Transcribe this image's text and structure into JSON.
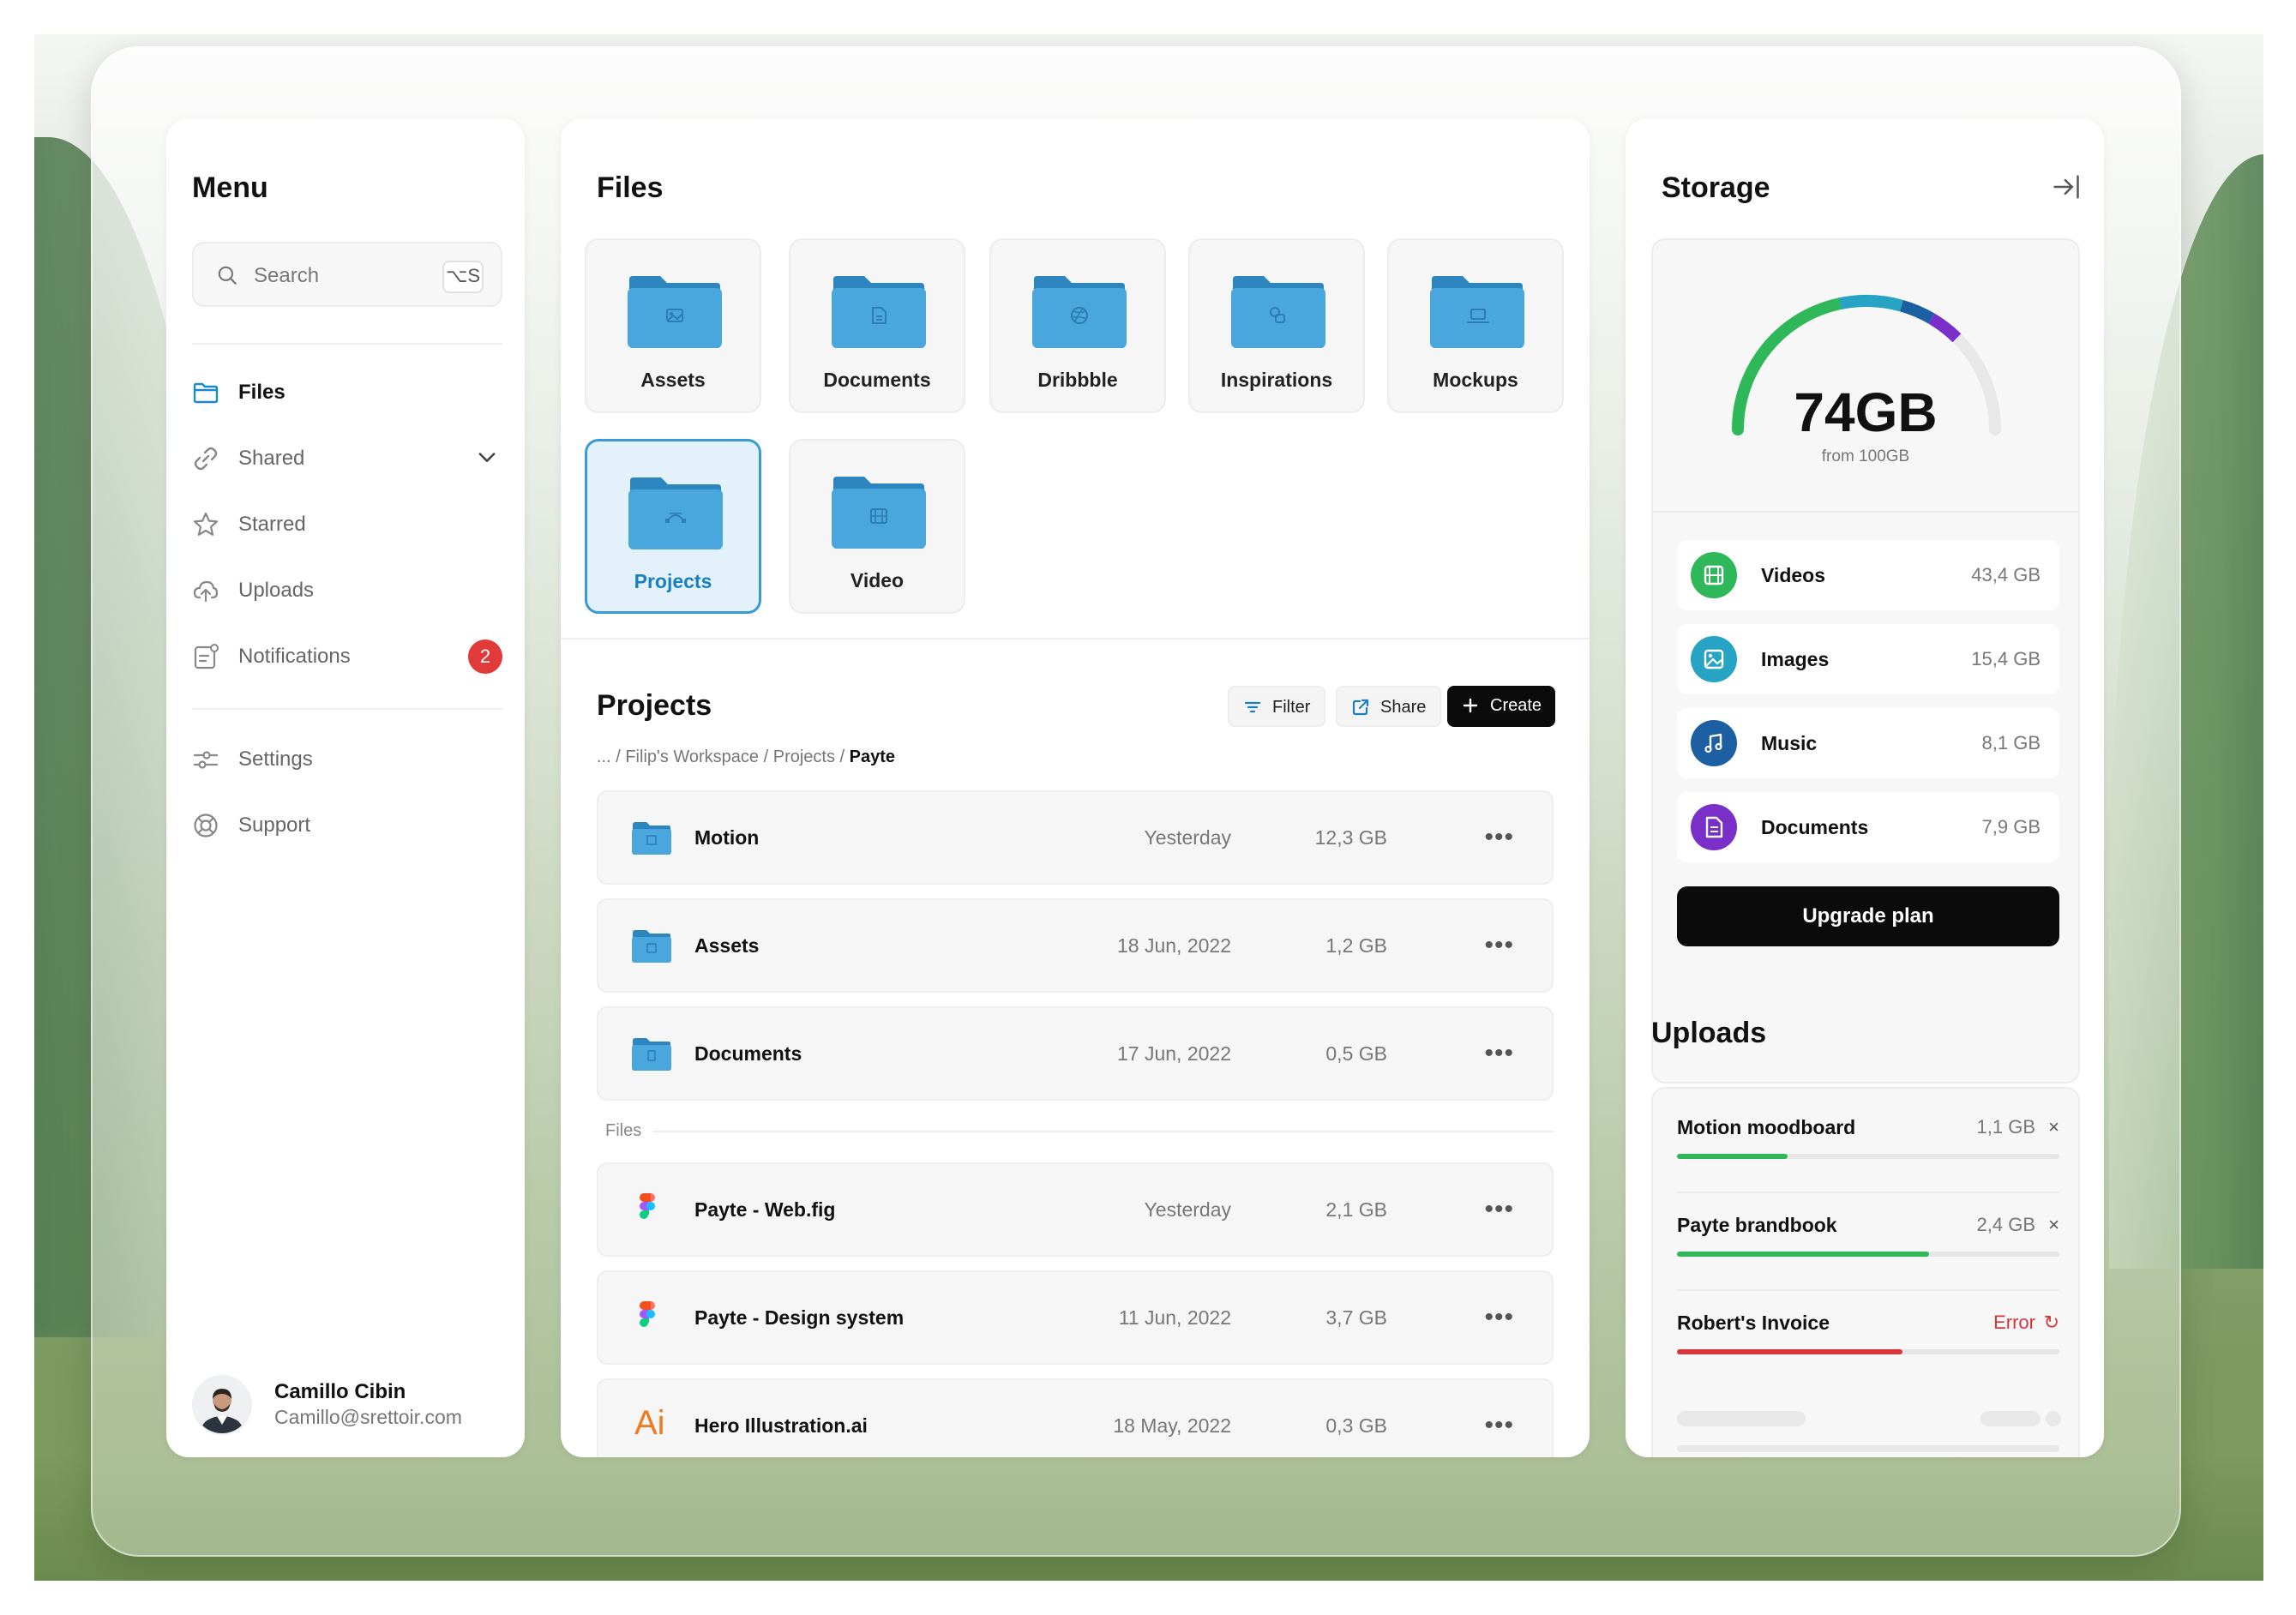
{
  "menu": {
    "title": "Menu",
    "search": {
      "placeholder": "Search",
      "shortcut": "⌥S"
    },
    "items": [
      {
        "label": "Files",
        "icon": "folder-icon",
        "active": true
      },
      {
        "label": "Shared",
        "icon": "link-icon"
      },
      {
        "label": "Starred",
        "icon": "star-icon"
      },
      {
        "label": "Uploads",
        "icon": "cloud-upload-icon"
      },
      {
        "label": "Notifications",
        "icon": "notification-icon",
        "badge": "2"
      }
    ],
    "bottom_items": [
      {
        "label": "Settings",
        "icon": "settings-sliders-icon"
      },
      {
        "label": "Support",
        "icon": "lifebuoy-icon"
      }
    ],
    "user": {
      "name": "Camillo Cibin",
      "email": "Camillo@srettoir.com"
    }
  },
  "files": {
    "title": "Files",
    "folders": [
      {
        "label": "Assets",
        "icon": "image-icon"
      },
      {
        "label": "Documents",
        "icon": "document-icon"
      },
      {
        "label": "Dribbble",
        "icon": "dribbble-icon"
      },
      {
        "label": "Inspirations",
        "icon": "shapes-icon"
      },
      {
        "label": "Mockups",
        "icon": "laptop-icon"
      },
      {
        "label": "Projects",
        "icon": "pen-tool-icon",
        "selected": true
      },
      {
        "label": "Video",
        "icon": "film-icon"
      }
    ],
    "folder_color": "#3d9ad3"
  },
  "projects": {
    "title": "Projects",
    "buttons": {
      "filter": "Filter",
      "share": "Share",
      "create": "Create"
    },
    "breadcrumb": {
      "path": "... / Filip's Workspace / Projects / ",
      "current": "Payte"
    },
    "folders": [
      {
        "name": "Motion",
        "date": "Yesterday",
        "size": "12,3 GB",
        "icon": "folder-film-icon"
      },
      {
        "name": "Assets",
        "date": "18 Jun, 2022",
        "size": "1,2 GB",
        "icon": "folder-image-icon"
      },
      {
        "name": "Documents",
        "date": "17 Jun, 2022",
        "size": "0,5 GB",
        "icon": "folder-document-icon"
      }
    ],
    "files_label": "Files",
    "files": [
      {
        "name": "Payte - Web.fig",
        "date": "Yesterday",
        "size": "2,1 GB",
        "icon": "figma-icon"
      },
      {
        "name": "Payte - Design system",
        "date": "11 Jun, 2022",
        "size": "3,7 GB",
        "icon": "figma-icon"
      },
      {
        "name": "Hero Illustration.ai",
        "date": "18 May, 2022",
        "size": "0,3 GB",
        "icon": "illustrator-icon",
        "icon_text": "Ai"
      }
    ],
    "more": "•••"
  },
  "storage": {
    "title": "Storage",
    "used": "74GB",
    "total": "from 100GB",
    "used_fraction": 0.74,
    "categories": [
      {
        "name": "Videos",
        "size": "43,4 GB",
        "color": "#2fb85a",
        "icon": "film-icon"
      },
      {
        "name": "Images",
        "size": "15,4 GB",
        "color": "#27a3c4",
        "icon": "image-icon"
      },
      {
        "name": "Music",
        "size": "8,1 GB",
        "color": "#1c5fa3",
        "icon": "music-icon"
      },
      {
        "name": "Documents",
        "size": "7,9 GB",
        "color": "#7a2fc9",
        "icon": "document-icon"
      }
    ],
    "upgrade": "Upgrade plan"
  },
  "uploads": {
    "title": "Uploads",
    "items": [
      {
        "name": "Motion moodboard",
        "size": "1,1 GB",
        "progress": 0.29,
        "color": "#2fb85a",
        "action": "×"
      },
      {
        "name": "Payte brandbook",
        "size": "2,4 GB",
        "progress": 0.66,
        "color": "#2fb85a",
        "action": "×"
      },
      {
        "name": "Robert's Invoice",
        "status": "Error",
        "progress": 0.59,
        "color": "#d6363c",
        "action": "↻"
      }
    ]
  }
}
